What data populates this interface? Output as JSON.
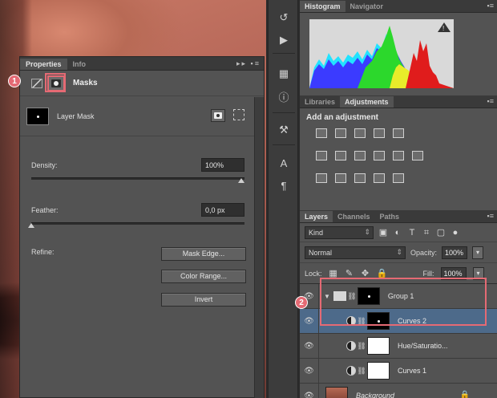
{
  "properties": {
    "tabs": [
      "Properties",
      "Info"
    ],
    "section_title": "Masks",
    "layer_mask_label": "Layer Mask",
    "density_label": "Density:",
    "density_value": "100%",
    "feather_label": "Feather:",
    "feather_value": "0,0 px",
    "refine_label": "Refine:",
    "buttons": [
      "Mask Edge...",
      "Color Range...",
      "Invert"
    ],
    "menu": "▸▸ ▪≡"
  },
  "badges": [
    "1",
    "2"
  ],
  "histogram": {
    "tabs": [
      "Histogram",
      "Navigator"
    ],
    "warning": "!"
  },
  "adjustments": {
    "tabs": [
      "Libraries",
      "Adjustments"
    ],
    "title": "Add an adjustment"
  },
  "layers": {
    "tabs": [
      "Layers",
      "Channels",
      "Paths"
    ],
    "kind_filter": "Kind",
    "blend_mode": "Normal",
    "opacity_label": "Opacity:",
    "opacity_value": "100%",
    "lock_label": "Lock:",
    "fill_label": "Fill:",
    "fill_value": "100%",
    "items": [
      {
        "name": "Group 1"
      },
      {
        "name": "Curves 2"
      },
      {
        "name": "Hue/Saturatio..."
      },
      {
        "name": "Curves 1"
      },
      {
        "name": "Background"
      }
    ]
  },
  "colors": {
    "highlight": "#e56a74",
    "selected_layer": "#4d6a8a",
    "panel_bg": "#535353"
  }
}
